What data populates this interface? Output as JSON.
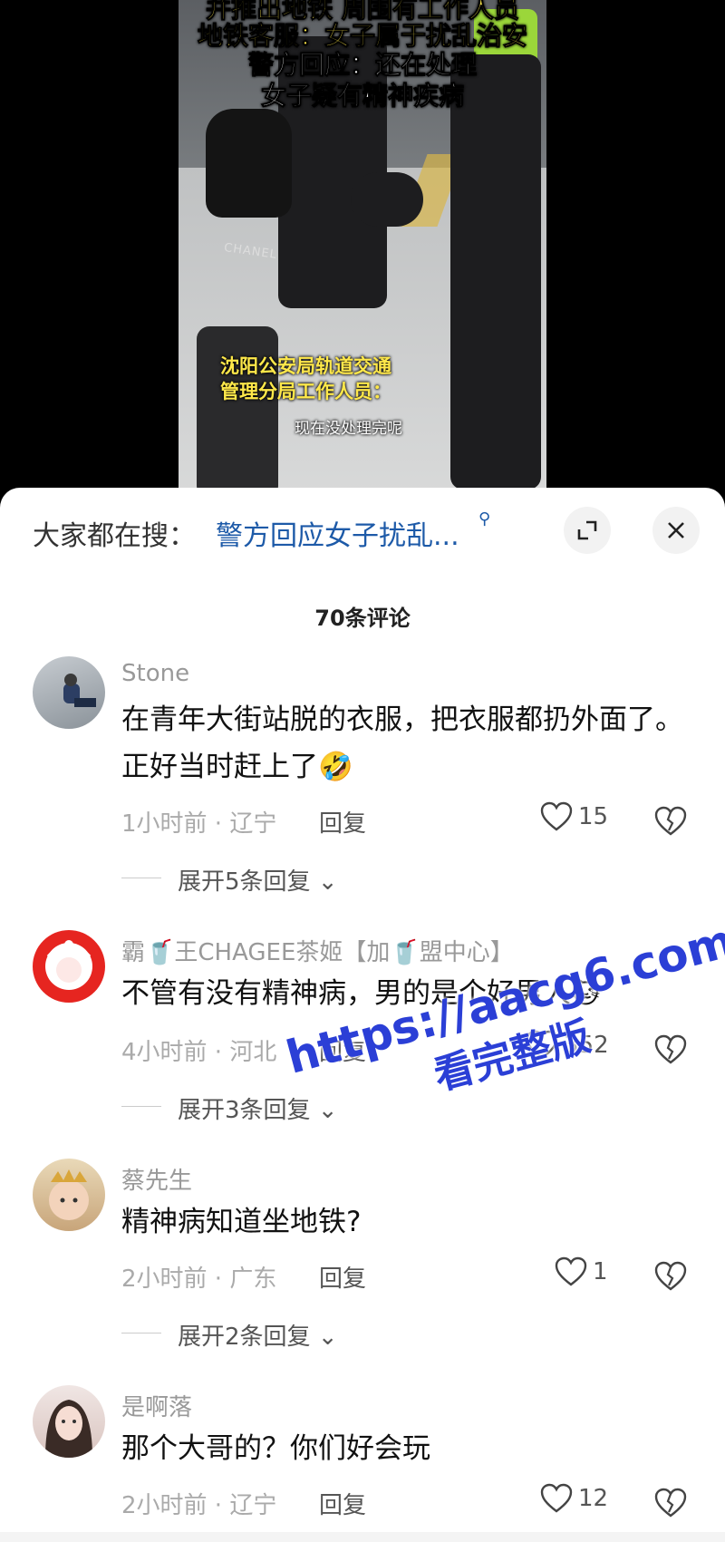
{
  "video": {
    "captions": [
      "并推出地铁 周围有工作人员",
      "地铁客服：女子属于扰乱治安",
      "警方回应：还在处理",
      "女子疑有精神疾病"
    ],
    "subtitle_speaker": [
      "沈阳公安局轨道交通",
      "管理分局工作人员："
    ],
    "subtitle_text": "现在没处理完呢",
    "bag_brand": "CHANEL"
  },
  "search": {
    "prefix": "大家都在搜：",
    "term": "警方回应女子扰乱...",
    "icon": "search-icon"
  },
  "comment_count": "70条评论",
  "comments": [
    {
      "username": "Stone",
      "text": "在青年大街站脱的衣服，把衣服都扔外面了。正好当时赶上了🤣",
      "meta": "1小时前 · 辽宁",
      "reply_label": "回复",
      "likes": "15",
      "expand": "展开5条回复"
    },
    {
      "username": "霸🥤王CHAGEE茶姬【加🥤盟中心】",
      "text": "不管有没有精神病，男的是个好男人🐱",
      "meta": "4小时前 · 河北",
      "reply_label": "回复",
      "likes": "352",
      "expand": "展开3条回复"
    },
    {
      "username": "蔡先生",
      "text": "精神病知道坐地铁?",
      "meta": "2小时前 · 广东",
      "reply_label": "回复",
      "likes": "1",
      "expand": "展开2条回复"
    },
    {
      "username": "是啊落",
      "text": "那个大哥的？你们好会玩",
      "meta": "2小时前 · 辽宁",
      "reply_label": "回复",
      "likes": "12",
      "expand": ""
    }
  ],
  "watermark": {
    "url": "https://aacg6.com",
    "sub": "看完整版",
    "color": "#2b3fd6"
  }
}
